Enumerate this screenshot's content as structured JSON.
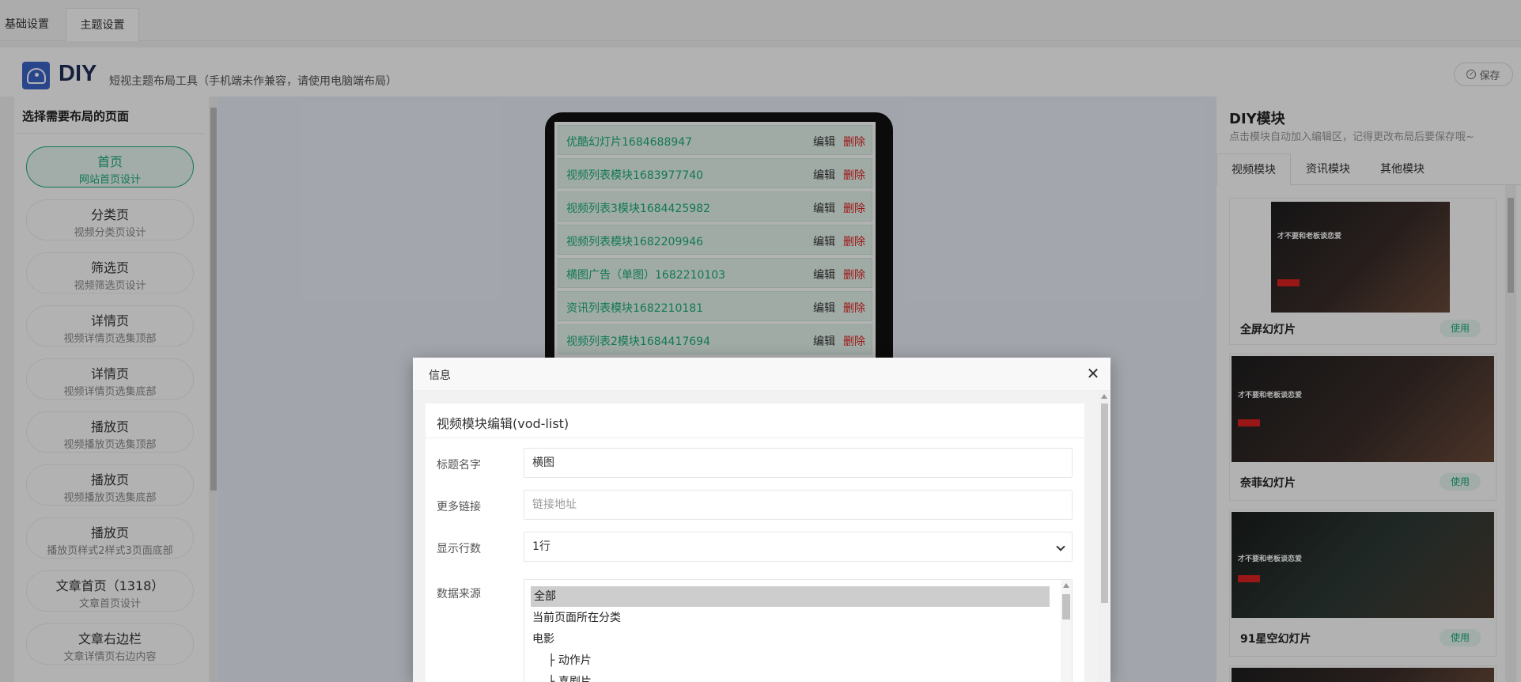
{
  "top_tabs": [
    "基础设置",
    "主题设置"
  ],
  "header": {
    "brand": "DIY",
    "desc": "短视主题布局工具（手机端未作兼容，请使用电脑端布局）",
    "save_label": "保存"
  },
  "left": {
    "title": "选择需要布局的页面",
    "pages": [
      {
        "name": "首页",
        "desc": "网站首页设计",
        "active": true
      },
      {
        "name": "分类页",
        "desc": "视频分类页设计"
      },
      {
        "name": "筛选页",
        "desc": "视频筛选页设计"
      },
      {
        "name": "详情页",
        "desc": "视频详情页选集顶部"
      },
      {
        "name": "详情页",
        "desc": "视频详情页选集底部"
      },
      {
        "name": "播放页",
        "desc": "视频播放页选集顶部"
      },
      {
        "name": "播放页",
        "desc": "视频播放页选集底部"
      },
      {
        "name": "播放页",
        "desc": "播放页样式2样式3页面底部"
      },
      {
        "name": "文章首页（1318）",
        "desc": "文章首页设计"
      },
      {
        "name": "文章右边栏",
        "desc": "文章详情页右边内容"
      }
    ]
  },
  "canvas": {
    "edit_label": "编辑",
    "delete_label": "删除",
    "modules": [
      "优酷幻灯片1684688947",
      "视频列表模块1683977740",
      "视频列表3模块1684425982",
      "视频列表模块1682209946",
      "横图广告（单图）1682210103",
      "资讯列表模块1682210181",
      "视频列表2模块1684417694"
    ]
  },
  "right": {
    "title": "DIY模块",
    "desc": "点击模块自动加入编辑区，记得更改布局后要保存哦~",
    "tabs": [
      "视频模块",
      "资讯模块",
      "其他模块"
    ],
    "use_label": "使用",
    "thumb_headline": "才不要和老板谈恋爱",
    "cards": [
      {
        "title": "全屏幻灯片"
      },
      {
        "title": "奈菲幻灯片"
      },
      {
        "title": "91星空幻灯片"
      }
    ]
  },
  "modal": {
    "title": "信息",
    "form_title": "视频模块编辑(vod-list)",
    "fields": {
      "title_label": "标题名字",
      "title_value": "横图",
      "link_label": "更多链接",
      "link_placeholder": "链接地址",
      "rows_label": "显示行数",
      "rows_value": "1行",
      "source_label": "数据来源"
    },
    "source_options": [
      "全部",
      "当前页面所在分类",
      "电影",
      "├ 动作片",
      "├ 喜剧片"
    ]
  },
  "colors": {
    "accent": "#1aad7a",
    "danger": "#e02020",
    "brand_blue": "#3b63c9"
  }
}
